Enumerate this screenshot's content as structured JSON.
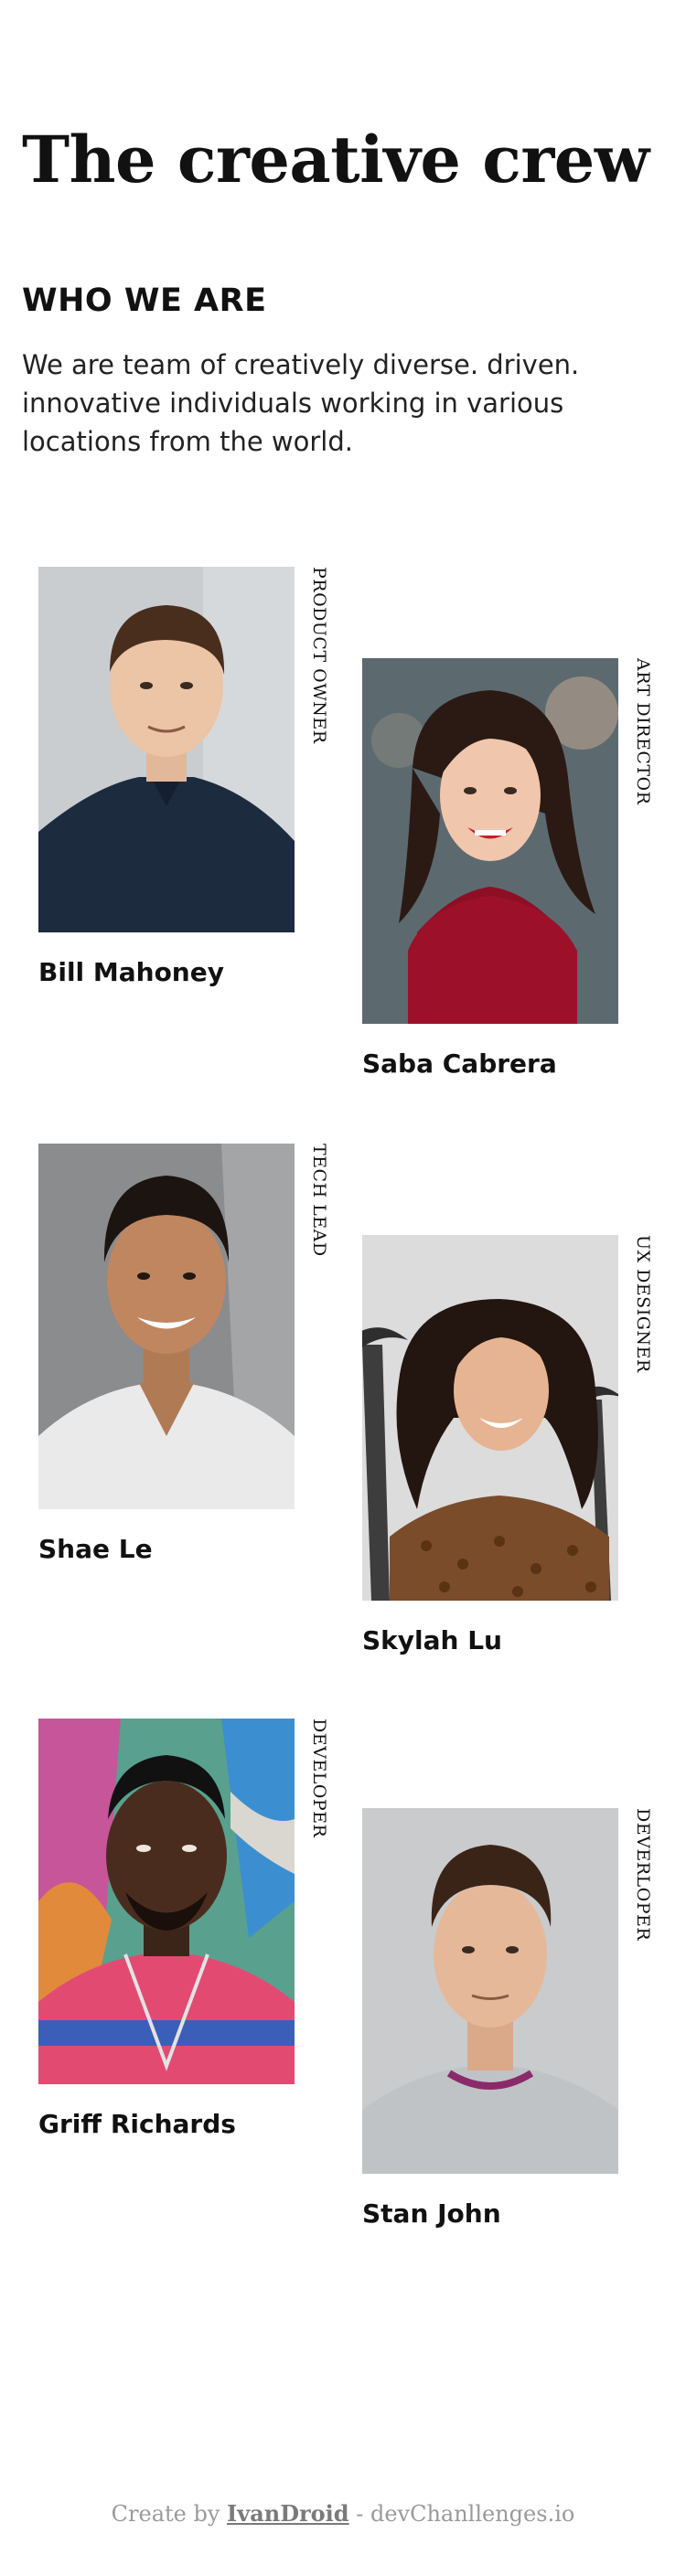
{
  "header": {
    "title": "The creative crew",
    "section_heading": "WHO WE ARE",
    "intro": "We are team of creatively diverse. driven. innovative individuals working in various locations from the world."
  },
  "members": [
    {
      "name": "Bill Mahoney",
      "role": "PRODUCT OWNER"
    },
    {
      "name": "Saba Cabrera",
      "role": "ART DIRECTOR"
    },
    {
      "name": "Shae Le",
      "role": "TECH LEAD"
    },
    {
      "name": "Skylah Lu",
      "role": "UX DESIGNER"
    },
    {
      "name": "Griff Richards",
      "role": "DEVELOPER"
    },
    {
      "name": "Stan John",
      "role": "DEVERLOPER"
    }
  ],
  "footer": {
    "prefix": "Create by ",
    "author": "IvanDroid",
    "suffix": " - devChanllenges.io"
  },
  "colors": {
    "text": "#111111",
    "footer_text": "#9a9a9a",
    "background": "#ffffff"
  }
}
